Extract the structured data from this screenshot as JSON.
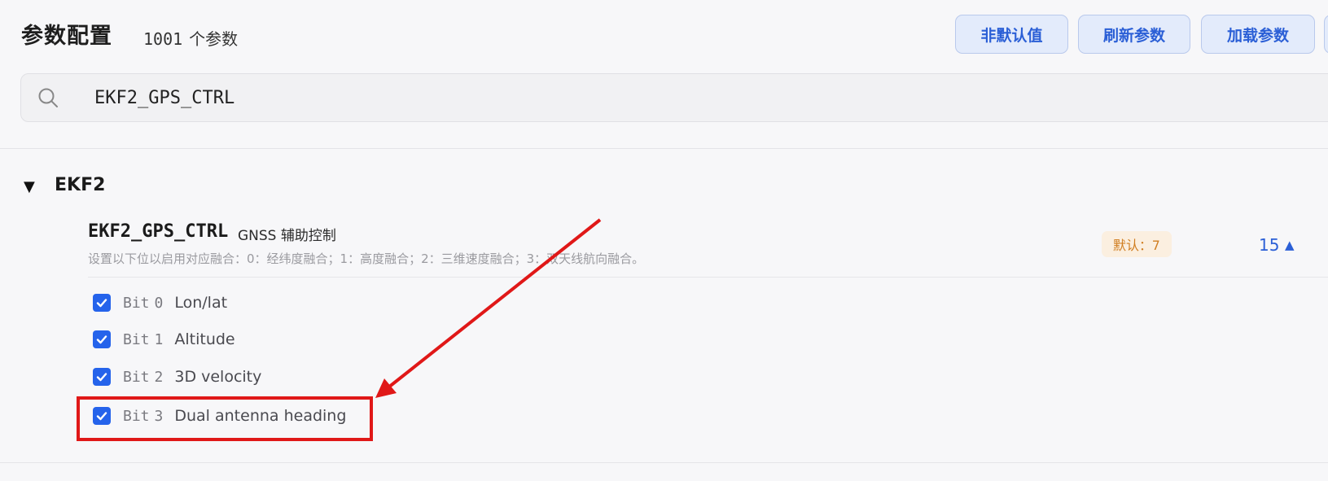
{
  "header": {
    "title": "参数配置",
    "count": "1001",
    "count_unit": "个参数",
    "buttons": {
      "non_default": "非默认值",
      "refresh": "刷新参数",
      "load": "加载参数"
    }
  },
  "search": {
    "value": "EKF2_GPS_CTRL",
    "icon": "search-icon"
  },
  "group": {
    "toggle_icon": "▼",
    "name": "EKF2"
  },
  "param": {
    "name": "EKF2_GPS_CTRL",
    "label": "GNSS 辅助控制",
    "description": "设置以下位以启用对应融合：0：经纬度融合；1：高度融合；2：三维速度融合；3：双天线航向融合。",
    "default_badge": "默认：7",
    "value": "15",
    "value_caret": "▲",
    "bits": [
      {
        "label": "Bit",
        "num": "0",
        "name": "Lon/lat",
        "checked": true
      },
      {
        "label": "Bit",
        "num": "1",
        "name": "Altitude",
        "checked": true
      },
      {
        "label": "Bit",
        "num": "2",
        "name": "3D velocity",
        "checked": true
      },
      {
        "label": "Bit",
        "num": "3",
        "name": "Dual antenna heading",
        "checked": true
      }
    ]
  },
  "annotation": {
    "color": "#e01818"
  }
}
